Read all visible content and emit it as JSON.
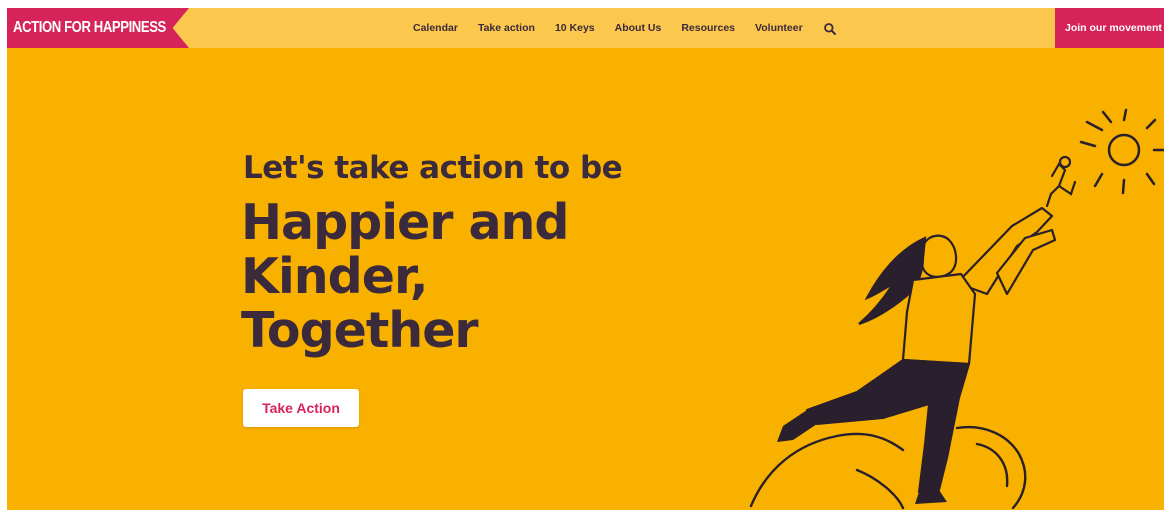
{
  "brand": {
    "logo_text": "ACTION FOR HAPPINESS"
  },
  "nav": {
    "items": [
      {
        "label": "Calendar"
      },
      {
        "label": "Take action"
      },
      {
        "label": "10 Keys"
      },
      {
        "label": "About Us"
      },
      {
        "label": "Resources"
      },
      {
        "label": "Volunteer"
      }
    ],
    "search_icon": "search-icon",
    "cta_label": "Join our movement"
  },
  "hero": {
    "subtitle": "Let's take action to be",
    "title_lines": [
      "Happier and",
      "Kinder,",
      "Together"
    ],
    "button_label": "Take Action"
  },
  "colors": {
    "background": "#f9b100",
    "topbar": "#fcc74d",
    "accent": "#d6245a",
    "text": "#3a2a3c",
    "white": "#ffffff"
  }
}
